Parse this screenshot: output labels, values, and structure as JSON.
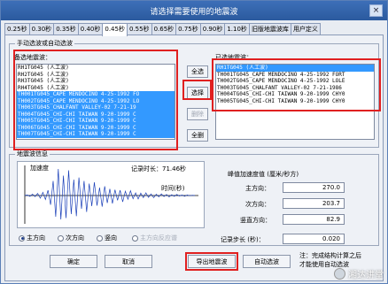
{
  "window": {
    "title": "请选择需要使用的地震波",
    "close_label": "×"
  },
  "tabs": [
    "0.25秒",
    "0.30秒",
    "0.35秒",
    "0.40秒",
    "0.45秒",
    "0.55秒",
    "0.65秒",
    "0.75秒",
    "0.90秒",
    "1.10秒",
    "旧版地震波库",
    "用户定义"
  ],
  "active_tab": 4,
  "selection_group": {
    "title": "手动选波或自动选波",
    "candidates_label": "备选地震波：",
    "candidates": [
      {
        "text": "RH1TG045 (人工波)",
        "selected": false
      },
      {
        "text": "RH2TG045 (人工波)",
        "selected": false
      },
      {
        "text": "RH3TG045 (人工波)",
        "selected": false
      },
      {
        "text": "RH4TG045 (人工波)",
        "selected": false
      },
      {
        "text": "TH001TG045_CAPE MENDOCINO 4-25-1992 FO",
        "selected": true
      },
      {
        "text": "TH002TG045_CAPE MENDOCINO 4-25-1992 LO",
        "selected": true
      },
      {
        "text": "TH003TG045_CHALFANT VALLEY-02 7-21-19",
        "selected": true
      },
      {
        "text": "TH004TG045_CHI-CHI TAIWAN 9-20-1999 C",
        "selected": true
      },
      {
        "text": "TH005TG045_CHI-CHI TAIWAN 9-20-1999 C",
        "selected": true
      },
      {
        "text": "TH006TG045_CHI-CHI TAIWAN 9-20-1999 C",
        "selected": true
      },
      {
        "text": "TH007TG045_CHI-CHI TAIWAN 9-20-1999 C",
        "selected": true
      }
    ],
    "buttons": {
      "select_all": "全选",
      "select": "选择",
      "delete": "删除",
      "delete_all": "全删"
    },
    "chosen_label": "已选地震波：",
    "chosen": [
      {
        "text": "RH1TG045 (人工波)",
        "selected": true
      },
      {
        "text": "TH001TG045_CAPE MENDOCINO 4-25-1992 FORT",
        "selected": false
      },
      {
        "text": "TH002TG045_CAPE MENDOCINO 4-25-1992 LOLE",
        "selected": false
      },
      {
        "text": "TH003TG045_CHALFANT VALLEY-02 7-21-1986",
        "selected": false
      },
      {
        "text": "TH004TG045_CHI-CHI TAIWAN 9-20-1999 CHY0",
        "selected": false
      },
      {
        "text": "TH005TG045_CHI-CHI TAIWAN 9-20-1999 CHY0",
        "selected": false
      }
    ]
  },
  "wave_info": {
    "title": "地震波信息",
    "y_label": "加速度",
    "duration_text": "记录时长：71.46秒",
    "x_label": "时间(秒)",
    "peak_title": "峰值加速度值 (厘米/秒方)",
    "main_dir_label": "主方向：",
    "main_dir_value": "270.0",
    "secondary_dir_label": "次方向：",
    "secondary_dir_value": "203.7",
    "vertical_dir_label": "竖直方向：",
    "vertical_dir_value": "82.9",
    "step_label": "记录步长 (秒)：",
    "step_value": "0.020",
    "radios": [
      {
        "label": "主方向",
        "checked": true,
        "disabled": false
      },
      {
        "label": "次方向",
        "checked": false,
        "disabled": false
      },
      {
        "label": "竖向",
        "checked": false,
        "disabled": false
      },
      {
        "label": "主方向反应谱",
        "checked": false,
        "disabled": true
      }
    ]
  },
  "footer": {
    "ok": "确定",
    "cancel": "取消",
    "export": "导出地震波",
    "auto_select": "自动选波",
    "note_line1": "注：完成结构计算之后",
    "note_line2": "才能使用自动选波"
  },
  "watermark": "湘达讲堂",
  "chart_data": {
    "type": "line",
    "title": "",
    "xlabel": "时间(秒)",
    "ylabel": "加速度",
    "x_range": [
      0,
      71.46
    ],
    "series": [
      {
        "values": [
          0,
          0.02,
          -0.03,
          0.05,
          -0.04,
          0.08,
          -0.1,
          0.12,
          -0.15,
          0.2,
          -0.35,
          0.55,
          -0.8,
          1.0,
          -0.9,
          0.75,
          -0.85,
          0.95,
          -0.7,
          0.6,
          -0.78,
          0.68,
          -0.5,
          0.55,
          -0.62,
          0.45,
          -0.4,
          0.5,
          -0.38,
          0.3,
          -0.42,
          0.35,
          -0.28,
          0.25,
          -0.3,
          0.22,
          -0.18,
          0.2,
          -0.24,
          0.16,
          -0.14,
          0.18,
          -0.12,
          0.1,
          -0.13,
          0.09,
          -0.08,
          0.1,
          -0.07,
          0.06,
          -0.08,
          0.05,
          -0.05,
          0.06,
          -0.04,
          0.04,
          -0.05,
          0.03,
          -0.03,
          0.04,
          -0.02,
          0.02,
          -0.03,
          0.02,
          -0.01,
          0.01,
          0
        ]
      }
    ]
  }
}
